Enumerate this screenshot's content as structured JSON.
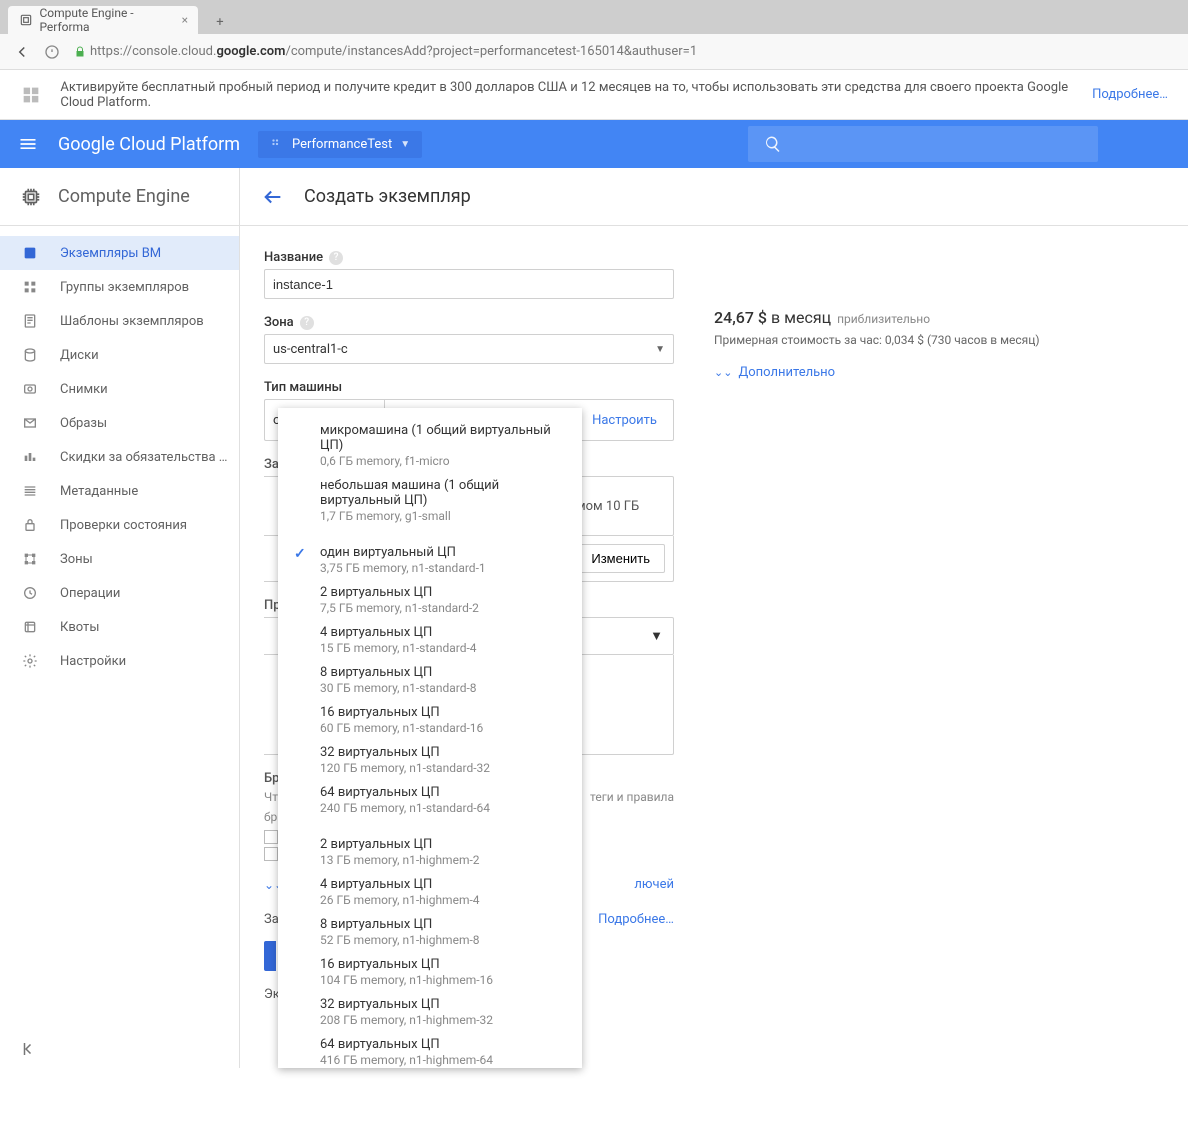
{
  "browser": {
    "tab_title": "Compute Engine - Performa",
    "url_prefix": "https://console.cloud.",
    "url_bold": "google.com",
    "url_suffix": "/compute/instancesAdd?project=performancetest-165014&authuser=1"
  },
  "promo": {
    "text": "Активируйте бесплатный пробный период и получите кредит в 300 долларов США и 12 месяцев на то, чтобы использовать эти средства для своего проекта Google Cloud Platform.",
    "link": "Подробнее…"
  },
  "topbar": {
    "logo": "Google Cloud Platform",
    "project": "PerformanceTest"
  },
  "sidebar": {
    "title": "Compute Engine",
    "items": [
      {
        "label": "Экземпляры ВМ",
        "active": true
      },
      {
        "label": "Группы экземпляров"
      },
      {
        "label": "Шаблоны экземпляров"
      },
      {
        "label": "Диски"
      },
      {
        "label": "Снимки"
      },
      {
        "label": "Образы"
      },
      {
        "label": "Скидки за обязательства …"
      },
      {
        "label": "Метаданные"
      },
      {
        "label": "Проверки состояния"
      },
      {
        "label": "Зоны"
      },
      {
        "label": "Операции"
      },
      {
        "label": "Квоты"
      },
      {
        "label": "Настройки"
      }
    ]
  },
  "page": {
    "title": "Создать экземпляр"
  },
  "form": {
    "name_label": "Название",
    "name_value": "instance-1",
    "zone_label": "Зона",
    "zone_value": "us-central1-c",
    "machine_type_label": "Тип машины",
    "machine_selected_short": "один виртуаль…",
    "machine_memory": "3,75 ГБ memory",
    "customize": "Настроить",
    "boot_label_partial": "За",
    "boot_size_partial": "мом 10 ГБ",
    "change_btn": "Изменить",
    "pr_label": "Пр",
    "br_label": "Бр",
    "firewall_hint_left": "Чт",
    "firewall_hint_right": "теги и правила",
    "firewall_hint2": "бр",
    "ssh_partial": "лючей",
    "equiv_left": "За",
    "equiv_link": "Подробнее…",
    "eq_left": "Эк"
  },
  "cost": {
    "price": "24,67 $",
    "per": "в месяц",
    "approx": "приблизительно",
    "hourly": "Примерная стоимость за час: 0,034 $ (730 часов в месяц)",
    "expand": "Дополнительно"
  },
  "machine_dropdown": {
    "groups": [
      [
        {
          "title": "микромашина (1 общий виртуальный ЦП)",
          "sub": "0,6 ГБ memory, f1-micro"
        },
        {
          "title": "небольшая машина (1 общий виртуальный ЦП)",
          "sub": "1,7 ГБ memory, g1-small"
        }
      ],
      [
        {
          "title": "один виртуальный ЦП",
          "sub": "3,75 ГБ memory, n1-standard-1",
          "selected": true
        },
        {
          "title": "2 виртуальных ЦП",
          "sub": "7,5 ГБ memory, n1-standard-2"
        },
        {
          "title": "4 виртуальных ЦП",
          "sub": "15 ГБ memory, n1-standard-4"
        },
        {
          "title": "8 виртуальных ЦП",
          "sub": "30 ГБ memory, n1-standard-8"
        },
        {
          "title": "16 виртуальных ЦП",
          "sub": "60 ГБ memory, n1-standard-16"
        },
        {
          "title": "32 виртуальных ЦП",
          "sub": "120 ГБ memory, n1-standard-32"
        },
        {
          "title": "64 виртуальных ЦП",
          "sub": "240 ГБ memory, n1-standard-64"
        }
      ],
      [
        {
          "title": "2 виртуальных ЦП",
          "sub": "13 ГБ memory, n1-highmem-2"
        },
        {
          "title": "4 виртуальных ЦП",
          "sub": "26 ГБ memory, n1-highmem-4"
        },
        {
          "title": "8 виртуальных ЦП",
          "sub": "52 ГБ memory, n1-highmem-8"
        },
        {
          "title": "16 виртуальных ЦП",
          "sub": "104 ГБ memory, n1-highmem-16"
        },
        {
          "title": "32 виртуальных ЦП",
          "sub": "208 ГБ memory, n1-highmem-32"
        },
        {
          "title": "64 виртуальных ЦП",
          "sub": "416 ГБ memory, n1-highmem-64"
        }
      ]
    ]
  }
}
